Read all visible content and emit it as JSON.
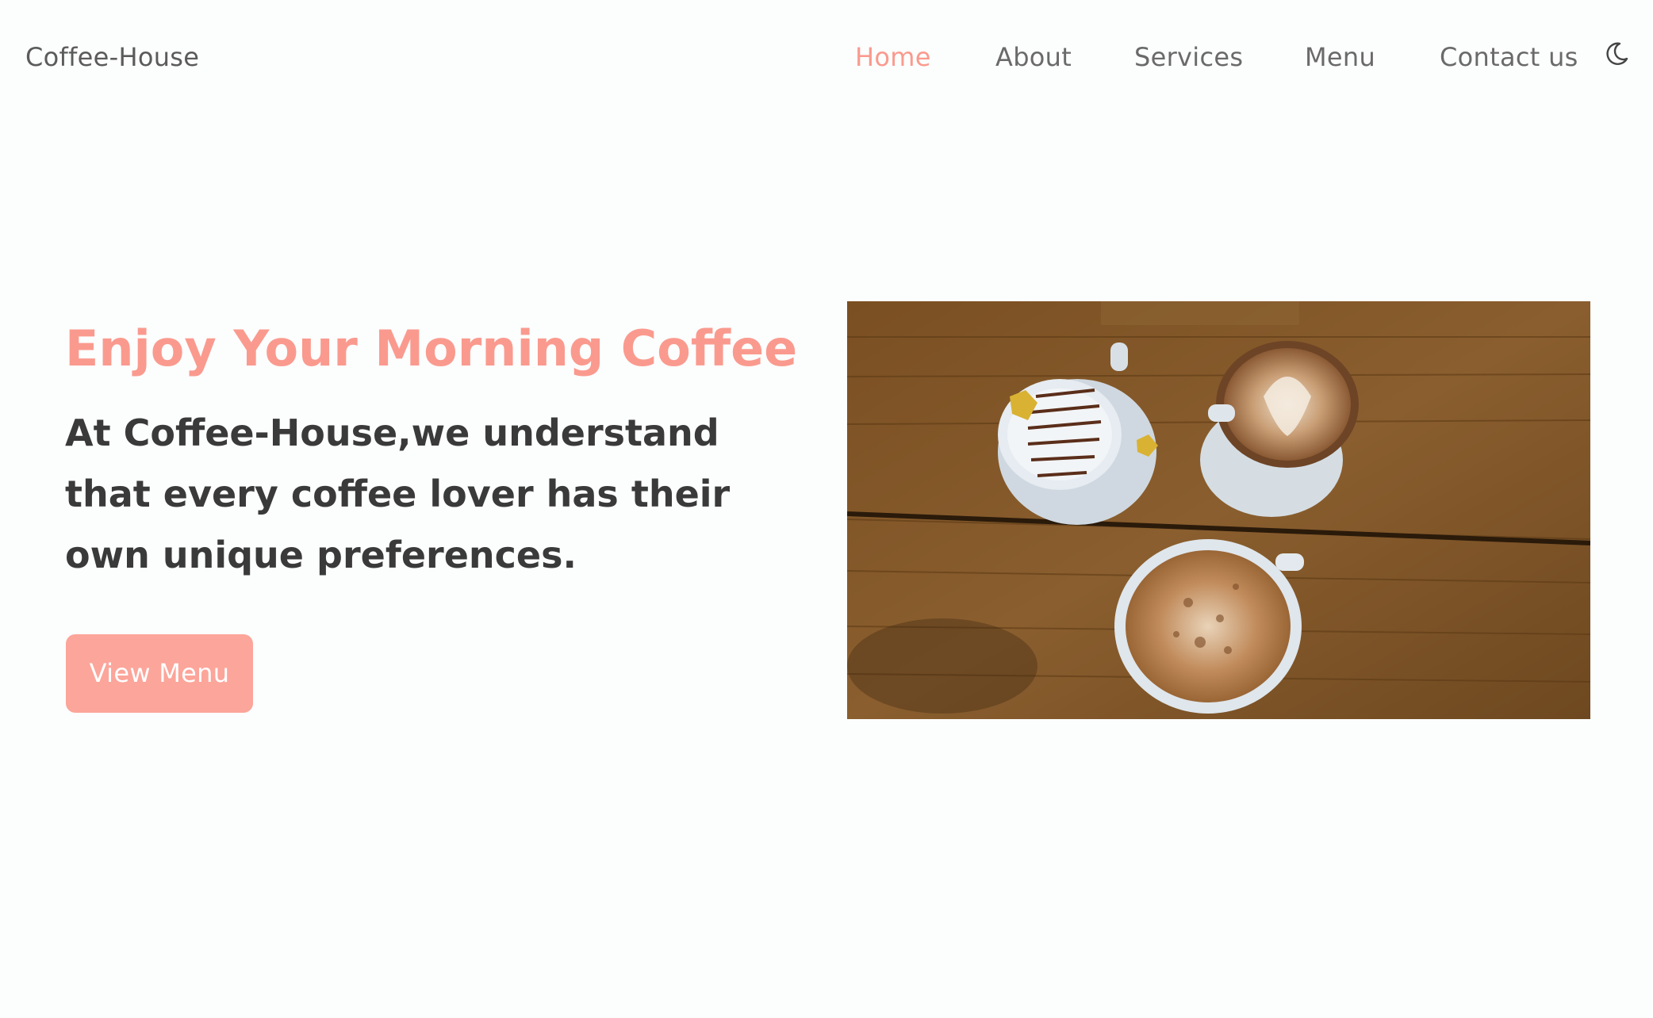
{
  "navbar": {
    "brand": "Coffee-House",
    "items": [
      {
        "label": "Home",
        "active": true
      },
      {
        "label": "About",
        "active": false
      },
      {
        "label": "Services",
        "active": false
      },
      {
        "label": "Menu",
        "active": false
      },
      {
        "label": "Contact us",
        "active": false
      }
    ],
    "theme_icon": "moon-icon"
  },
  "hero": {
    "title": "Enjoy Your Morning Coffee",
    "text": "At Coffee-House,we understand that every coffee lover has their own unique preferences.",
    "button_label": "View Menu",
    "image_subject": "three-coffee-cups-on-wooden-table"
  },
  "colors": {
    "accent": "#fa9a8e",
    "button": "#fca59a",
    "heading_text": "#3a3a3a",
    "nav_text": "#6a6a6a",
    "background": "#fcfdfd"
  }
}
